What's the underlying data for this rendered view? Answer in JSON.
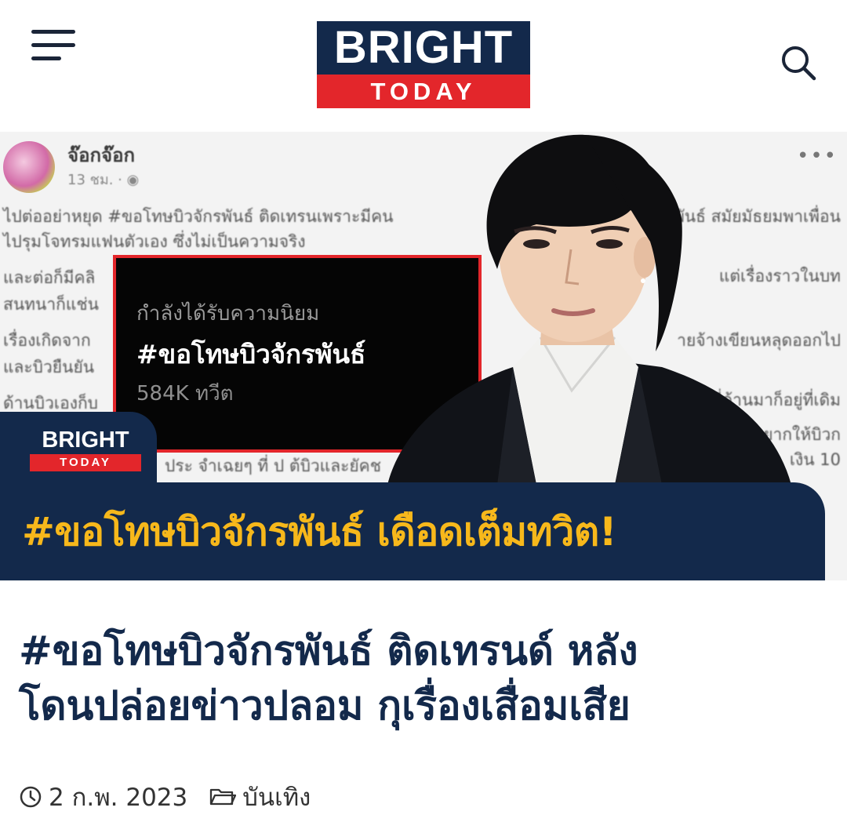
{
  "header": {
    "logo_top": "BRIGHT",
    "logo_bottom": "TODAY"
  },
  "hero": {
    "fb_post": {
      "author": "จ๊อกจ๊อก",
      "time": "13 ชม. · ",
      "lines_left": [
        "ไปต่ออย่าหยุด #ขอโทษบิวจักรพันธ์ ติดเทรนเพราะมีคน",
        "ไปรุมโจทรมแฟนตัวเอง ซึ่งไม่เป็นความจริง",
        "และต่อก็มีคลิ",
        "สนทนาก็แช่น",
        "เรื่องเกิดจาก",
        "และบิวยืนยัน",
        "ด้านบิวเองก็บ"
      ],
      "lines_right": [
        "พันธ์ สมัยมัธยมพาเพื่อน",
        "แต่เรื่องราวในบท",
        "ายจ้างเขียนหลุดออกไป",
        "งที่ด้านมาก็อยู่ที่เดิม",
        "ยากให้บิวก",
        "เงิน 10"
      ],
      "line_bottom": "ประ จำเฉยๆ ที่ ป ต้บิวและยัคช"
    },
    "trend_card": {
      "label": "กำลังได้รับความนิยม",
      "hashtag": "#ขอโทษบิวจักรพันธ์",
      "count": "584K ทวีต"
    },
    "badge": {
      "top": "BRIGHT",
      "bottom": "TODAY"
    },
    "headline": "#ขอโทษบิวจักรพันธ์ เดือดเต็มทวิต!"
  },
  "article": {
    "title_line1": "#ขอโทษบิวจักรพันธ์ ติดเทรนด์ หลัง",
    "title_line2": "โดนปล่อยข่าวปลอม กุเรื่องเสื่อมเสีย",
    "date": "2 ก.พ. 2023",
    "category": "บันเทิง"
  },
  "colors": {
    "navy": "#13294b",
    "red": "#e3262b",
    "headline_yellow": "#f7b81b"
  },
  "icons": [
    "menu-icon",
    "search-icon",
    "clock-icon",
    "folder-icon"
  ]
}
